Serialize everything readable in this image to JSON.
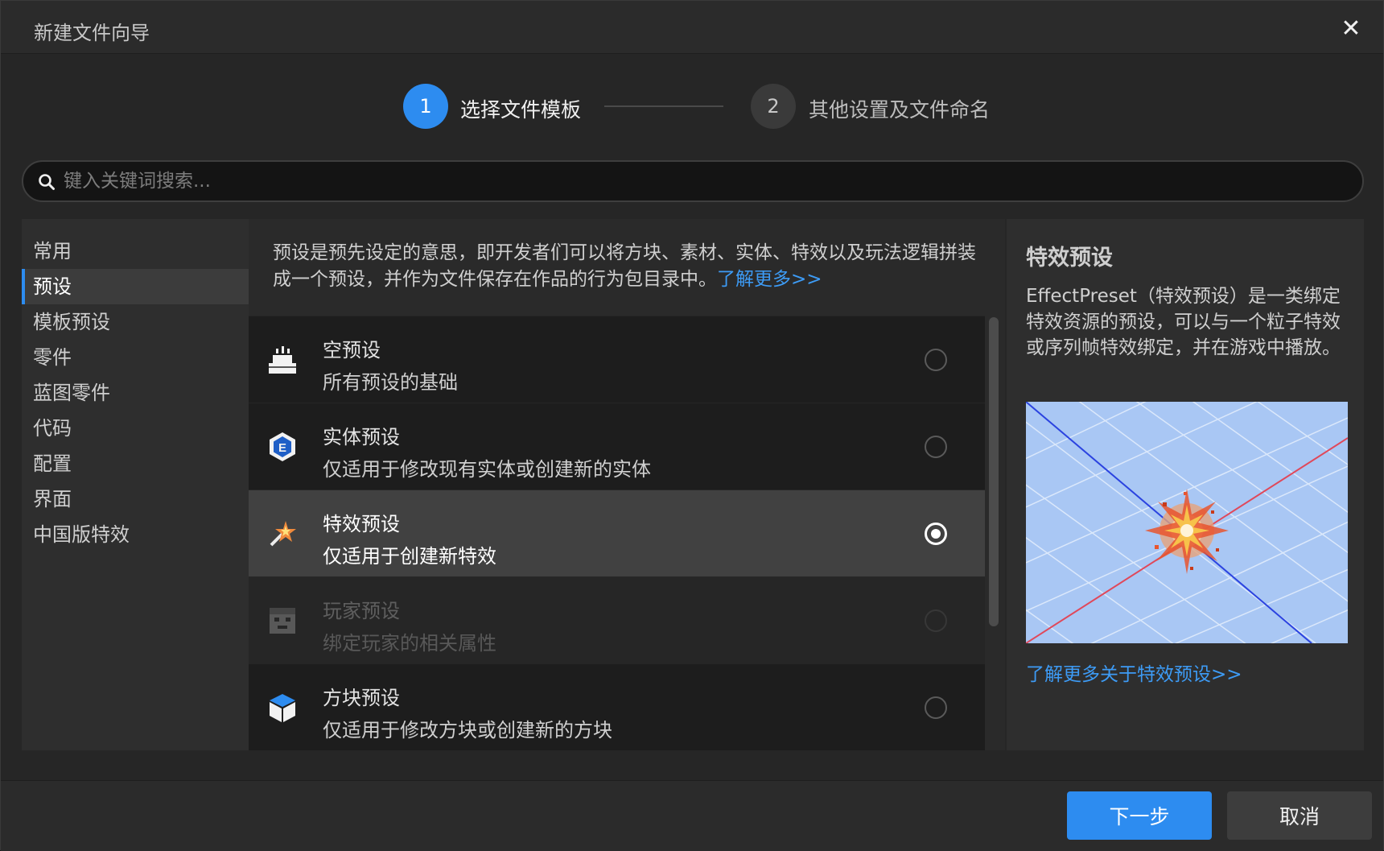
{
  "dialog": {
    "title": "新建文件向导",
    "close_label": "✕"
  },
  "steps": [
    {
      "number": "1",
      "label": "选择文件模板",
      "state": "active"
    },
    {
      "number": "2",
      "label": "其他设置及文件命名",
      "state": "inactive"
    }
  ],
  "search": {
    "placeholder": "键入关键词搜索...",
    "value": ""
  },
  "categories": [
    {
      "label": "常用",
      "active": false
    },
    {
      "label": "预设",
      "active": true
    },
    {
      "label": "模板预设",
      "active": false
    },
    {
      "label": "零件",
      "active": false
    },
    {
      "label": "蓝图零件",
      "active": false
    },
    {
      "label": "代码",
      "active": false
    },
    {
      "label": "配置",
      "active": false
    },
    {
      "label": "界面",
      "active": false
    },
    {
      "label": "中国版特效",
      "active": false
    }
  ],
  "intro": {
    "text": "预设是预先设定的意思，即开发者们可以将方块、素材、实体、特效以及玩法逻辑拼装成一个预设，并作为文件保存在作品的行为包目录中。",
    "more": "了解更多>>"
  },
  "templates": [
    {
      "name": "空预设",
      "desc": "所有预设的基础",
      "icon": "empty-preset-icon",
      "selected": false,
      "disabled": false
    },
    {
      "name": "实体预设",
      "desc": "仅适用于修改现有实体或创建新的实体",
      "icon": "entity-preset-icon",
      "selected": false,
      "disabled": false
    },
    {
      "name": "特效预设",
      "desc": "仅适用于创建新特效",
      "icon": "effect-preset-icon",
      "selected": true,
      "disabled": false
    },
    {
      "name": "玩家预设",
      "desc": "绑定玩家的相关属性",
      "icon": "player-preset-icon",
      "selected": false,
      "disabled": true
    },
    {
      "name": "方块预设",
      "desc": "仅适用于修改方块或创建新的方块",
      "icon": "block-preset-icon",
      "selected": false,
      "disabled": false
    }
  ],
  "detail": {
    "title": "特效预设",
    "desc": "EffectPreset（特效预设）是一类绑定特效资源的预设，可以与一个粒子特效或序列帧特效绑定，并在游戏中播放。",
    "more": "了解更多关于特效预设>>"
  },
  "footer": {
    "next_label": "下一步",
    "cancel_label": "取消"
  },
  "colors": {
    "accent": "#2d8cf0",
    "link": "#3d9bf5",
    "background": "#262626",
    "selected_row": "#414141"
  }
}
